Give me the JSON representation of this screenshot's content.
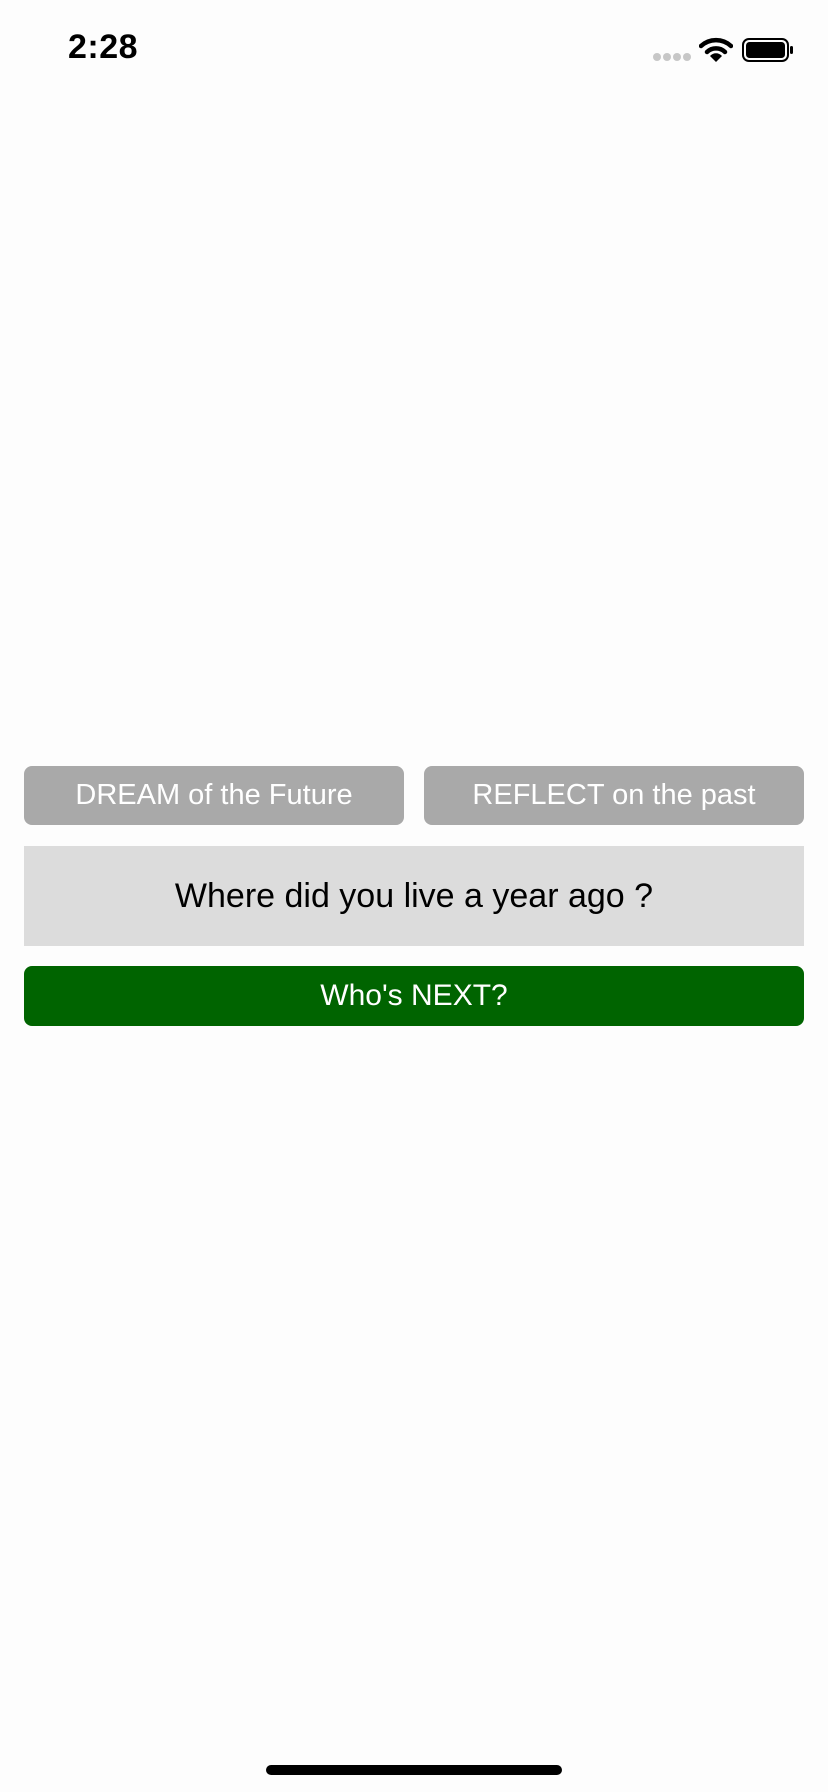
{
  "status_bar": {
    "time": "2:28",
    "icons": [
      "signal-dots-icon",
      "wifi-icon",
      "battery-icon"
    ]
  },
  "buttons": {
    "dream_label": "DREAM of the Future",
    "reflect_label": "REFLECT on the past",
    "next_label": "Who's NEXT?"
  },
  "question": {
    "text": "Where did you live a year ago ?"
  },
  "colors": {
    "mode_button_bg": "#a9a9a9",
    "question_bg": "#dcdcdc",
    "next_button_bg": "#006400",
    "background": "#fdfdfd"
  }
}
